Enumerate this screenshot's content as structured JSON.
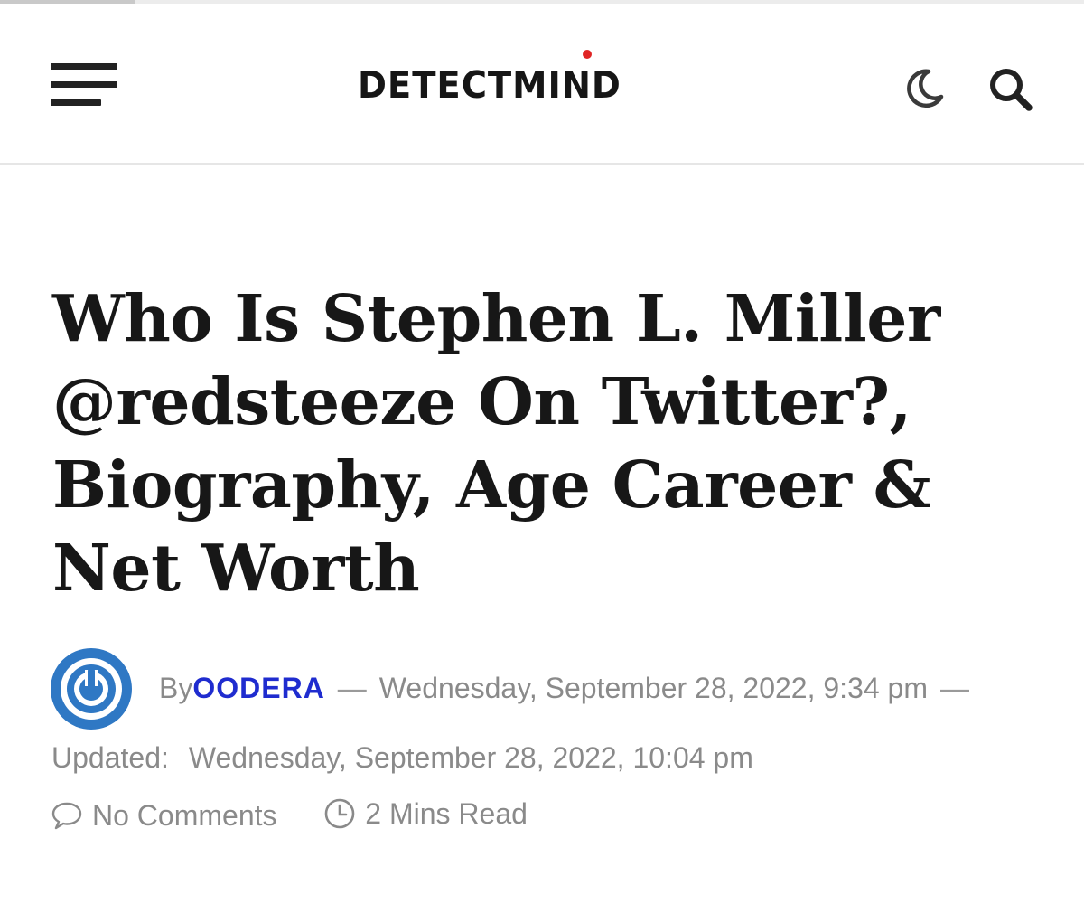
{
  "header": {
    "logo_text": "DETECTMIND",
    "menu_icon": "hamburger-menu-icon",
    "dark_mode_icon": "moon-icon",
    "search_icon": "search-icon",
    "logo_dot_color": "#e02525"
  },
  "article": {
    "title": "Who Is Stephen L. Miller @redsteeze On Twitter?, Biography, Age Career & Net Worth",
    "by_label": "By",
    "author": "OODERA",
    "author_color": "#1f2ccf",
    "separator": "—",
    "published": "Wednesday, September 28, 2022, 9:34 pm",
    "updated_label": "Updated:",
    "updated": "Wednesday, September 28, 2022, 10:04 pm",
    "comments_icon": "comment-icon",
    "comments": "No Comments",
    "read_time_icon": "clock-icon",
    "read_time": "2 Mins Read"
  }
}
